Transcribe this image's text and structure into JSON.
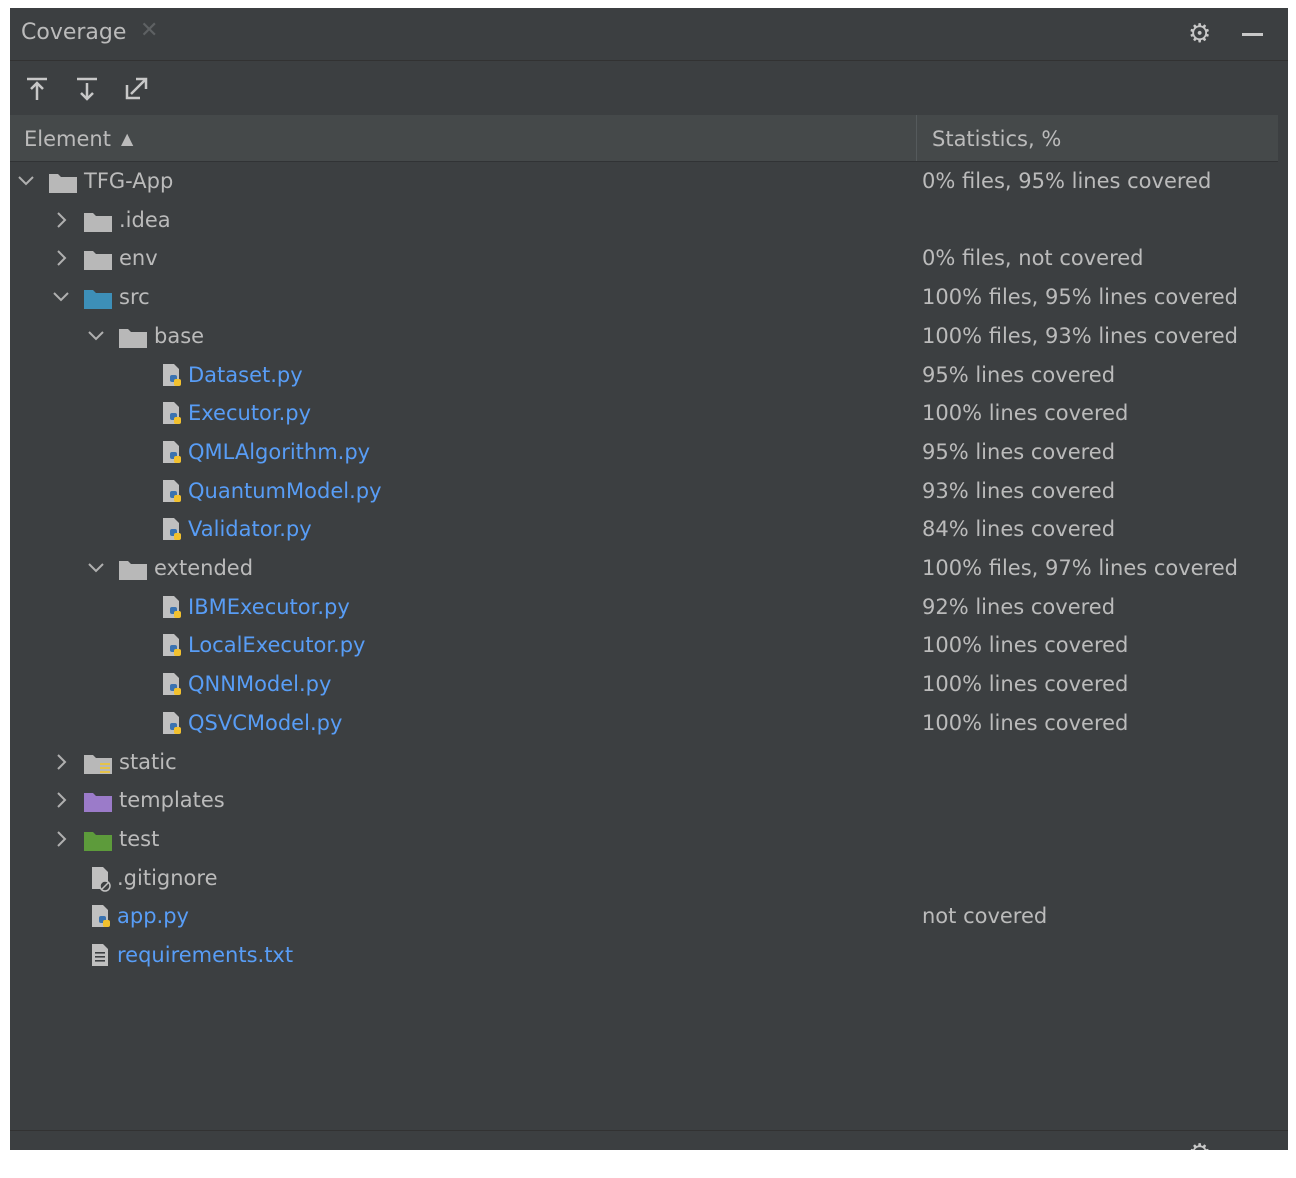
{
  "window": {
    "title": "Coverage"
  },
  "toolbar": {
    "buttons": [
      "import-icon",
      "export-icon",
      "navigate-icon"
    ]
  },
  "columns": {
    "element": "Element",
    "statistics": "Statistics, %"
  },
  "rows": [
    {
      "name": "TFG-App",
      "kind": "folder",
      "color": "#b8b8b8",
      "depth": 0,
      "state": "expanded",
      "stat": "0% files, 95% lines covered"
    },
    {
      "name": ".idea",
      "kind": "folder",
      "color": "#b8b8b8",
      "depth": 1,
      "state": "collapsed",
      "stat": ""
    },
    {
      "name": "env",
      "kind": "folder",
      "color": "#b8b8b8",
      "depth": 1,
      "state": "collapsed",
      "stat": "0% files, not covered"
    },
    {
      "name": "src",
      "kind": "folder",
      "color": "#3d8fb8",
      "depth": 1,
      "state": "expanded",
      "stat": "100% files, 95% lines covered"
    },
    {
      "name": "base",
      "kind": "folder",
      "color": "#b8b8b8",
      "depth": 2,
      "state": "expanded",
      "stat": "100% files, 93% lines covered"
    },
    {
      "name": "Dataset.py",
      "kind": "python",
      "depth": 3,
      "state": "leaf",
      "stat": "95% lines covered"
    },
    {
      "name": "Executor.py",
      "kind": "python",
      "depth": 3,
      "state": "leaf",
      "stat": "100% lines covered"
    },
    {
      "name": "QMLAlgorithm.py",
      "kind": "python",
      "depth": 3,
      "state": "leaf",
      "stat": "95% lines covered"
    },
    {
      "name": "QuantumModel.py",
      "kind": "python",
      "depth": 3,
      "state": "leaf",
      "stat": "93% lines covered"
    },
    {
      "name": "Validator.py",
      "kind": "python",
      "depth": 3,
      "state": "leaf",
      "stat": "84% lines covered"
    },
    {
      "name": "extended",
      "kind": "folder",
      "color": "#b8b8b8",
      "depth": 2,
      "state": "expanded",
      "stat": "100% files, 97% lines covered"
    },
    {
      "name": "IBMExecutor.py",
      "kind": "python",
      "depth": 3,
      "state": "leaf",
      "stat": "92% lines covered"
    },
    {
      "name": "LocalExecutor.py",
      "kind": "python",
      "depth": 3,
      "state": "leaf",
      "stat": "100% lines covered"
    },
    {
      "name": "QNNModel.py",
      "kind": "python",
      "depth": 3,
      "state": "leaf",
      "stat": "100% lines covered"
    },
    {
      "name": "QSVCModel.py",
      "kind": "python",
      "depth": 3,
      "state": "leaf",
      "stat": "100% lines covered"
    },
    {
      "name": "static",
      "kind": "folder-resources",
      "color": "#b8b8b8",
      "depth": 1,
      "state": "collapsed",
      "stat": ""
    },
    {
      "name": "templates",
      "kind": "folder",
      "color": "#9b7bc9",
      "depth": 1,
      "state": "collapsed",
      "stat": ""
    },
    {
      "name": "test",
      "kind": "folder",
      "color": "#5d9b3b",
      "depth": 1,
      "state": "collapsed",
      "stat": ""
    },
    {
      "name": ".gitignore",
      "kind": "ignored",
      "depth": 2,
      "state": "leaf",
      "stat": ""
    },
    {
      "name": "app.py",
      "kind": "python",
      "depth": 2,
      "state": "leaf",
      "stat": "not covered"
    },
    {
      "name": "requirements.txt",
      "kind": "text",
      "depth": 2,
      "state": "leaf",
      "stat": ""
    }
  ],
  "colors": {
    "background": "#3c3f41",
    "text": "#bbbbbb",
    "python_file": "#589df6",
    "header_bg": "#45494a"
  }
}
